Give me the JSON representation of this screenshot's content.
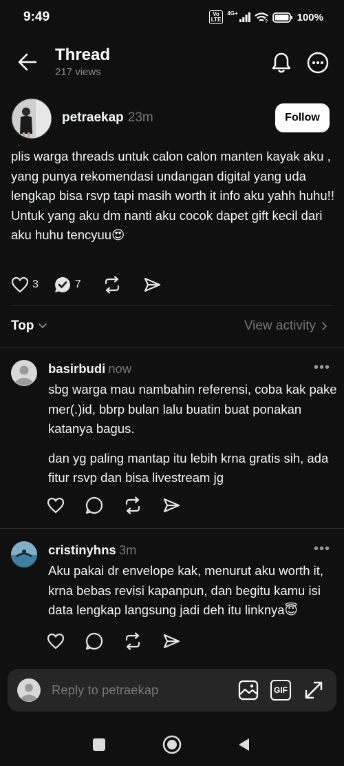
{
  "status_bar": {
    "time": "9:49",
    "volte": "Vo\nLTE",
    "network": "4G+",
    "battery": "100%"
  },
  "header": {
    "title": "Thread",
    "views": "217 views"
  },
  "post": {
    "username": "petraekap",
    "time": "23m",
    "follow_label": "Follow",
    "body_line1": "plis warga threads untuk calon calon manten kayak aku , yang punya rekomendasi undangan digital yang uda lengkap bisa rsvp tapi masih worth it info aku yahh huhu!!",
    "body_line2": "Untuk yang aku dm nanti aku cocok dapet gift kecil dari aku huhu tencyuu😍",
    "likes": "3",
    "replies": "7"
  },
  "sort": {
    "label": "Top",
    "view_activity": "View activity"
  },
  "comments": [
    {
      "username": "basirbudi",
      "time": "now",
      "paragraph1": "sbg warga mau nambahin referensi, coba kak pake mer(.)id, bbrp bulan lalu buatin buat ponakan katanya bagus.",
      "paragraph2": "dan yg paling mantap itu lebih krna gratis sih, ada fitur rsvp dan bisa livestream jg"
    },
    {
      "username": "cristinyhns",
      "time": "3m",
      "paragraph1": "Aku pakai dr envelope kak, menurut aku worth it, krna bebas revisi kapanpun, dan begitu kamu isi data lengkap langsung jadi deh itu linknya😇"
    }
  ],
  "reply_bar": {
    "placeholder": "Reply to petraekap",
    "gif_label": "GIF"
  },
  "colors": {
    "background": "#101010",
    "text": "#f3f5f7",
    "muted": "#777777",
    "input_bg": "#262626"
  }
}
